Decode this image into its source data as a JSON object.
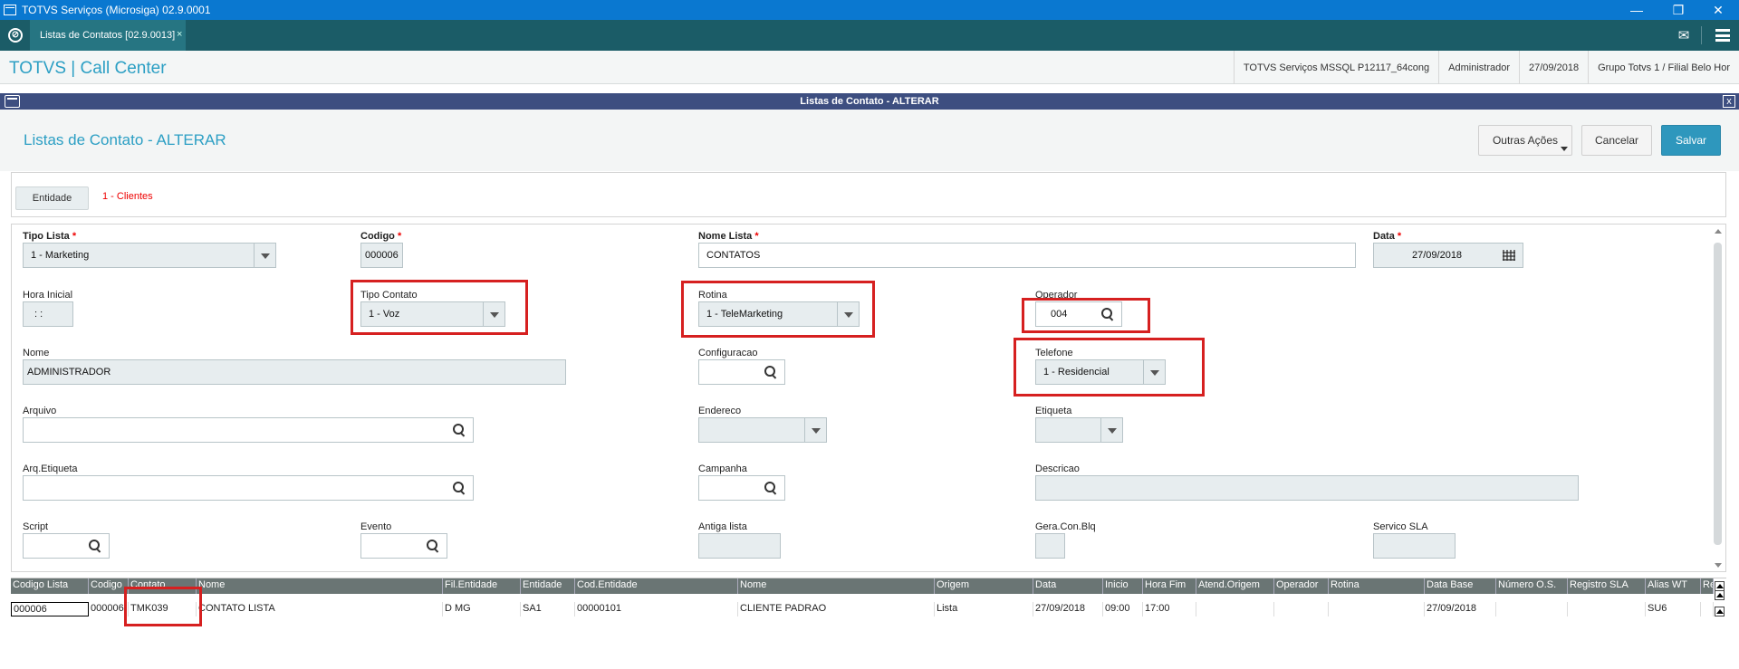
{
  "window": {
    "title": "TOTVS Serviços (Microsiga) 02.9.0001",
    "minimize": "—",
    "restore": "❐",
    "close": "✕"
  },
  "tabbar": {
    "tab_label": "Listas de Contatos [02.9.0013]",
    "tab_close": "×",
    "mail_icon": "✉"
  },
  "header": {
    "brand": "TOTVS | Call Center",
    "info": [
      "TOTVS Serviços MSSQL P12117_64cong",
      "Administrador",
      "27/09/2018",
      "Grupo Totvs 1 / Filial Belo Hor"
    ]
  },
  "dialog": {
    "bar_title": "Listas de Contato - ALTERAR",
    "close": "x",
    "title": "Listas de Contato - ALTERAR",
    "buttons": {
      "other": "Outras Ações",
      "cancel": "Cancelar",
      "save": "Salvar"
    }
  },
  "entity": {
    "button": "Entidade",
    "value": "1 - Clientes"
  },
  "form": {
    "tipo_lista": {
      "label": "Tipo Lista",
      "value": "1 - Marketing"
    },
    "codigo": {
      "label": "Codigo",
      "value": "000006"
    },
    "nome_lista": {
      "label": "Nome Lista",
      "value": "CONTATOS"
    },
    "data": {
      "label": "Data",
      "value": "27/09/2018"
    },
    "hora_inicial": {
      "label": "Hora Inicial",
      "value": " :  :"
    },
    "tipo_contato": {
      "label": "Tipo Contato",
      "value": "1 - Voz"
    },
    "rotina": {
      "label": "Rotina",
      "value": "1 - TeleMarketing"
    },
    "operador": {
      "label": "Operador",
      "value": "004"
    },
    "nome": {
      "label": "Nome",
      "value": "ADMINISTRADOR"
    },
    "configuracao": {
      "label": "Configuracao",
      "value": ""
    },
    "telefone": {
      "label": "Telefone",
      "value": "1 - Residencial"
    },
    "arquivo": {
      "label": "Arquivo",
      "value": ""
    },
    "endereco": {
      "label": "Endereco",
      "value": ""
    },
    "etiqueta": {
      "label": "Etiqueta",
      "value": ""
    },
    "arq_etiqueta": {
      "label": "Arq.Etiqueta",
      "value": ""
    },
    "campanha": {
      "label": "Campanha",
      "value": ""
    },
    "descricao": {
      "label": "Descricao",
      "value": ""
    },
    "script": {
      "label": "Script",
      "value": ""
    },
    "evento": {
      "label": "Evento",
      "value": ""
    },
    "antiga_lista": {
      "label": "Antiga lista",
      "value": ""
    },
    "gera_con_blq": {
      "label": "Gera.Con.Blq",
      "value": ""
    },
    "servico_sla": {
      "label": "Servico SLA",
      "value": ""
    },
    "required_mark": "*"
  },
  "grid": {
    "columns": [
      "Codigo Lista",
      "Codigo",
      "Contato",
      "Nome",
      "Fil.Entidade",
      "Entidade",
      "Cod.Entidade",
      "Nome",
      "Origem",
      "Data",
      "Inicio",
      "Hora Fim",
      "Atend.Origem",
      "Operador",
      "Rotina",
      "Data Base",
      "Número O.S.",
      "Registro SLA",
      "Alias WT",
      "Re"
    ],
    "rows": [
      [
        "000006",
        "000006",
        "TMK039",
        "CONTATO LISTA",
        "D MG",
        "SA1",
        "00000101",
        "CLIENTE PADRAO",
        "Lista",
        "27/09/2018",
        "09:00",
        "17:00",
        "",
        "",
        "",
        "27/09/2018",
        "",
        "",
        "SU6",
        ""
      ]
    ]
  }
}
